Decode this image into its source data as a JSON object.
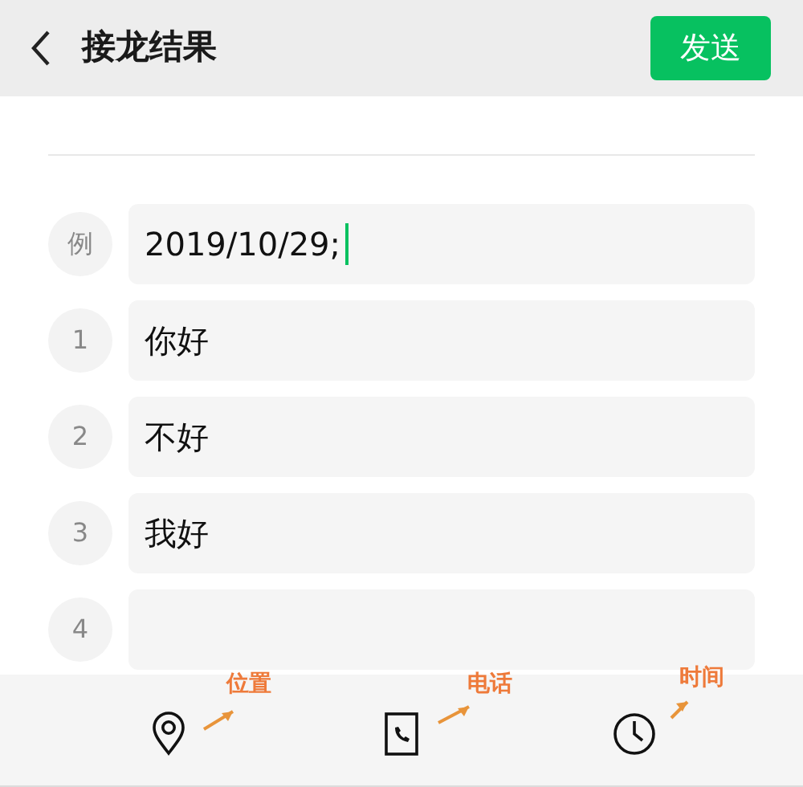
{
  "header": {
    "title": "接龙结果",
    "send_button": "发送"
  },
  "entries": [
    {
      "marker": "例",
      "value": "2019/10/29;",
      "focused": true
    },
    {
      "marker": "1",
      "value": "你好",
      "focused": false
    },
    {
      "marker": "2",
      "value": "不好",
      "focused": false
    },
    {
      "marker": "3",
      "value": "我好",
      "focused": false
    },
    {
      "marker": "4",
      "focused": false
    }
  ],
  "toolbar": [
    {
      "kind": "location",
      "annotation": "位置"
    },
    {
      "kind": "phone",
      "annotation": "电话"
    },
    {
      "kind": "time",
      "annotation": "时间"
    }
  ]
}
